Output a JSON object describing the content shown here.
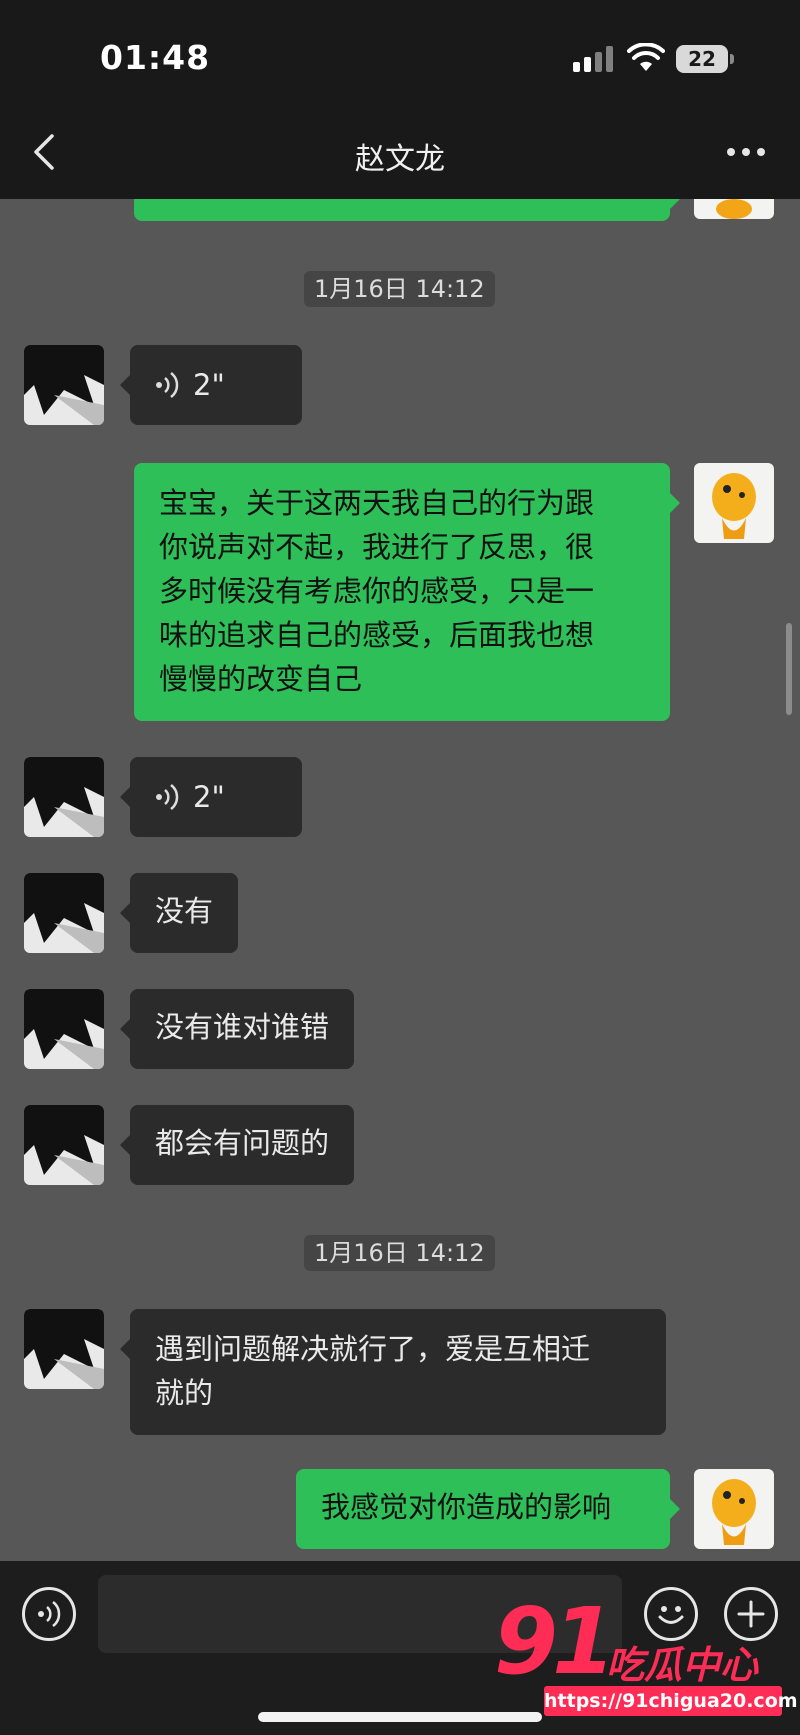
{
  "status_bar": {
    "time": "01:48",
    "battery": "22"
  },
  "header": {
    "title": "赵文龙"
  },
  "messages": [
    {
      "type": "timestamp",
      "text": "1月16日 14:12"
    },
    {
      "type": "voice",
      "side": "left",
      "duration": "2\""
    },
    {
      "type": "text",
      "side": "right",
      "lines": [
        "宝宝，关于这两天我自己的行为跟",
        "你说声对不起，我进行了反思，很",
        "多时候没有考虑你的感受，只是一",
        "味的追求自己的感受，后面我也想",
        "慢慢的改变自己"
      ]
    },
    {
      "type": "voice",
      "side": "left",
      "duration": "2\""
    },
    {
      "type": "text",
      "side": "left",
      "lines": [
        "没有"
      ]
    },
    {
      "type": "text",
      "side": "left",
      "lines": [
        "没有谁对谁错"
      ]
    },
    {
      "type": "text",
      "side": "left",
      "lines": [
        "都会有问题的"
      ]
    },
    {
      "type": "timestamp",
      "text": "1月16日 14:12"
    },
    {
      "type": "text",
      "side": "left",
      "lines": [
        "遇到问题解决就行了，爱是互相迁",
        "就的"
      ]
    },
    {
      "type": "text",
      "side": "right",
      "lines": [
        "我感觉对你造成的影响"
      ]
    }
  ],
  "input": {
    "value": "",
    "placeholder": ""
  },
  "watermark": {
    "number": "91",
    "name": "吃瓜中心",
    "url": "https://91chigua20.com"
  },
  "colors": {
    "sent_bubble": "#2ebf59",
    "received_bubble": "#2b2b2b",
    "chat_background": "#575757",
    "watermark": "#ff2c55"
  }
}
